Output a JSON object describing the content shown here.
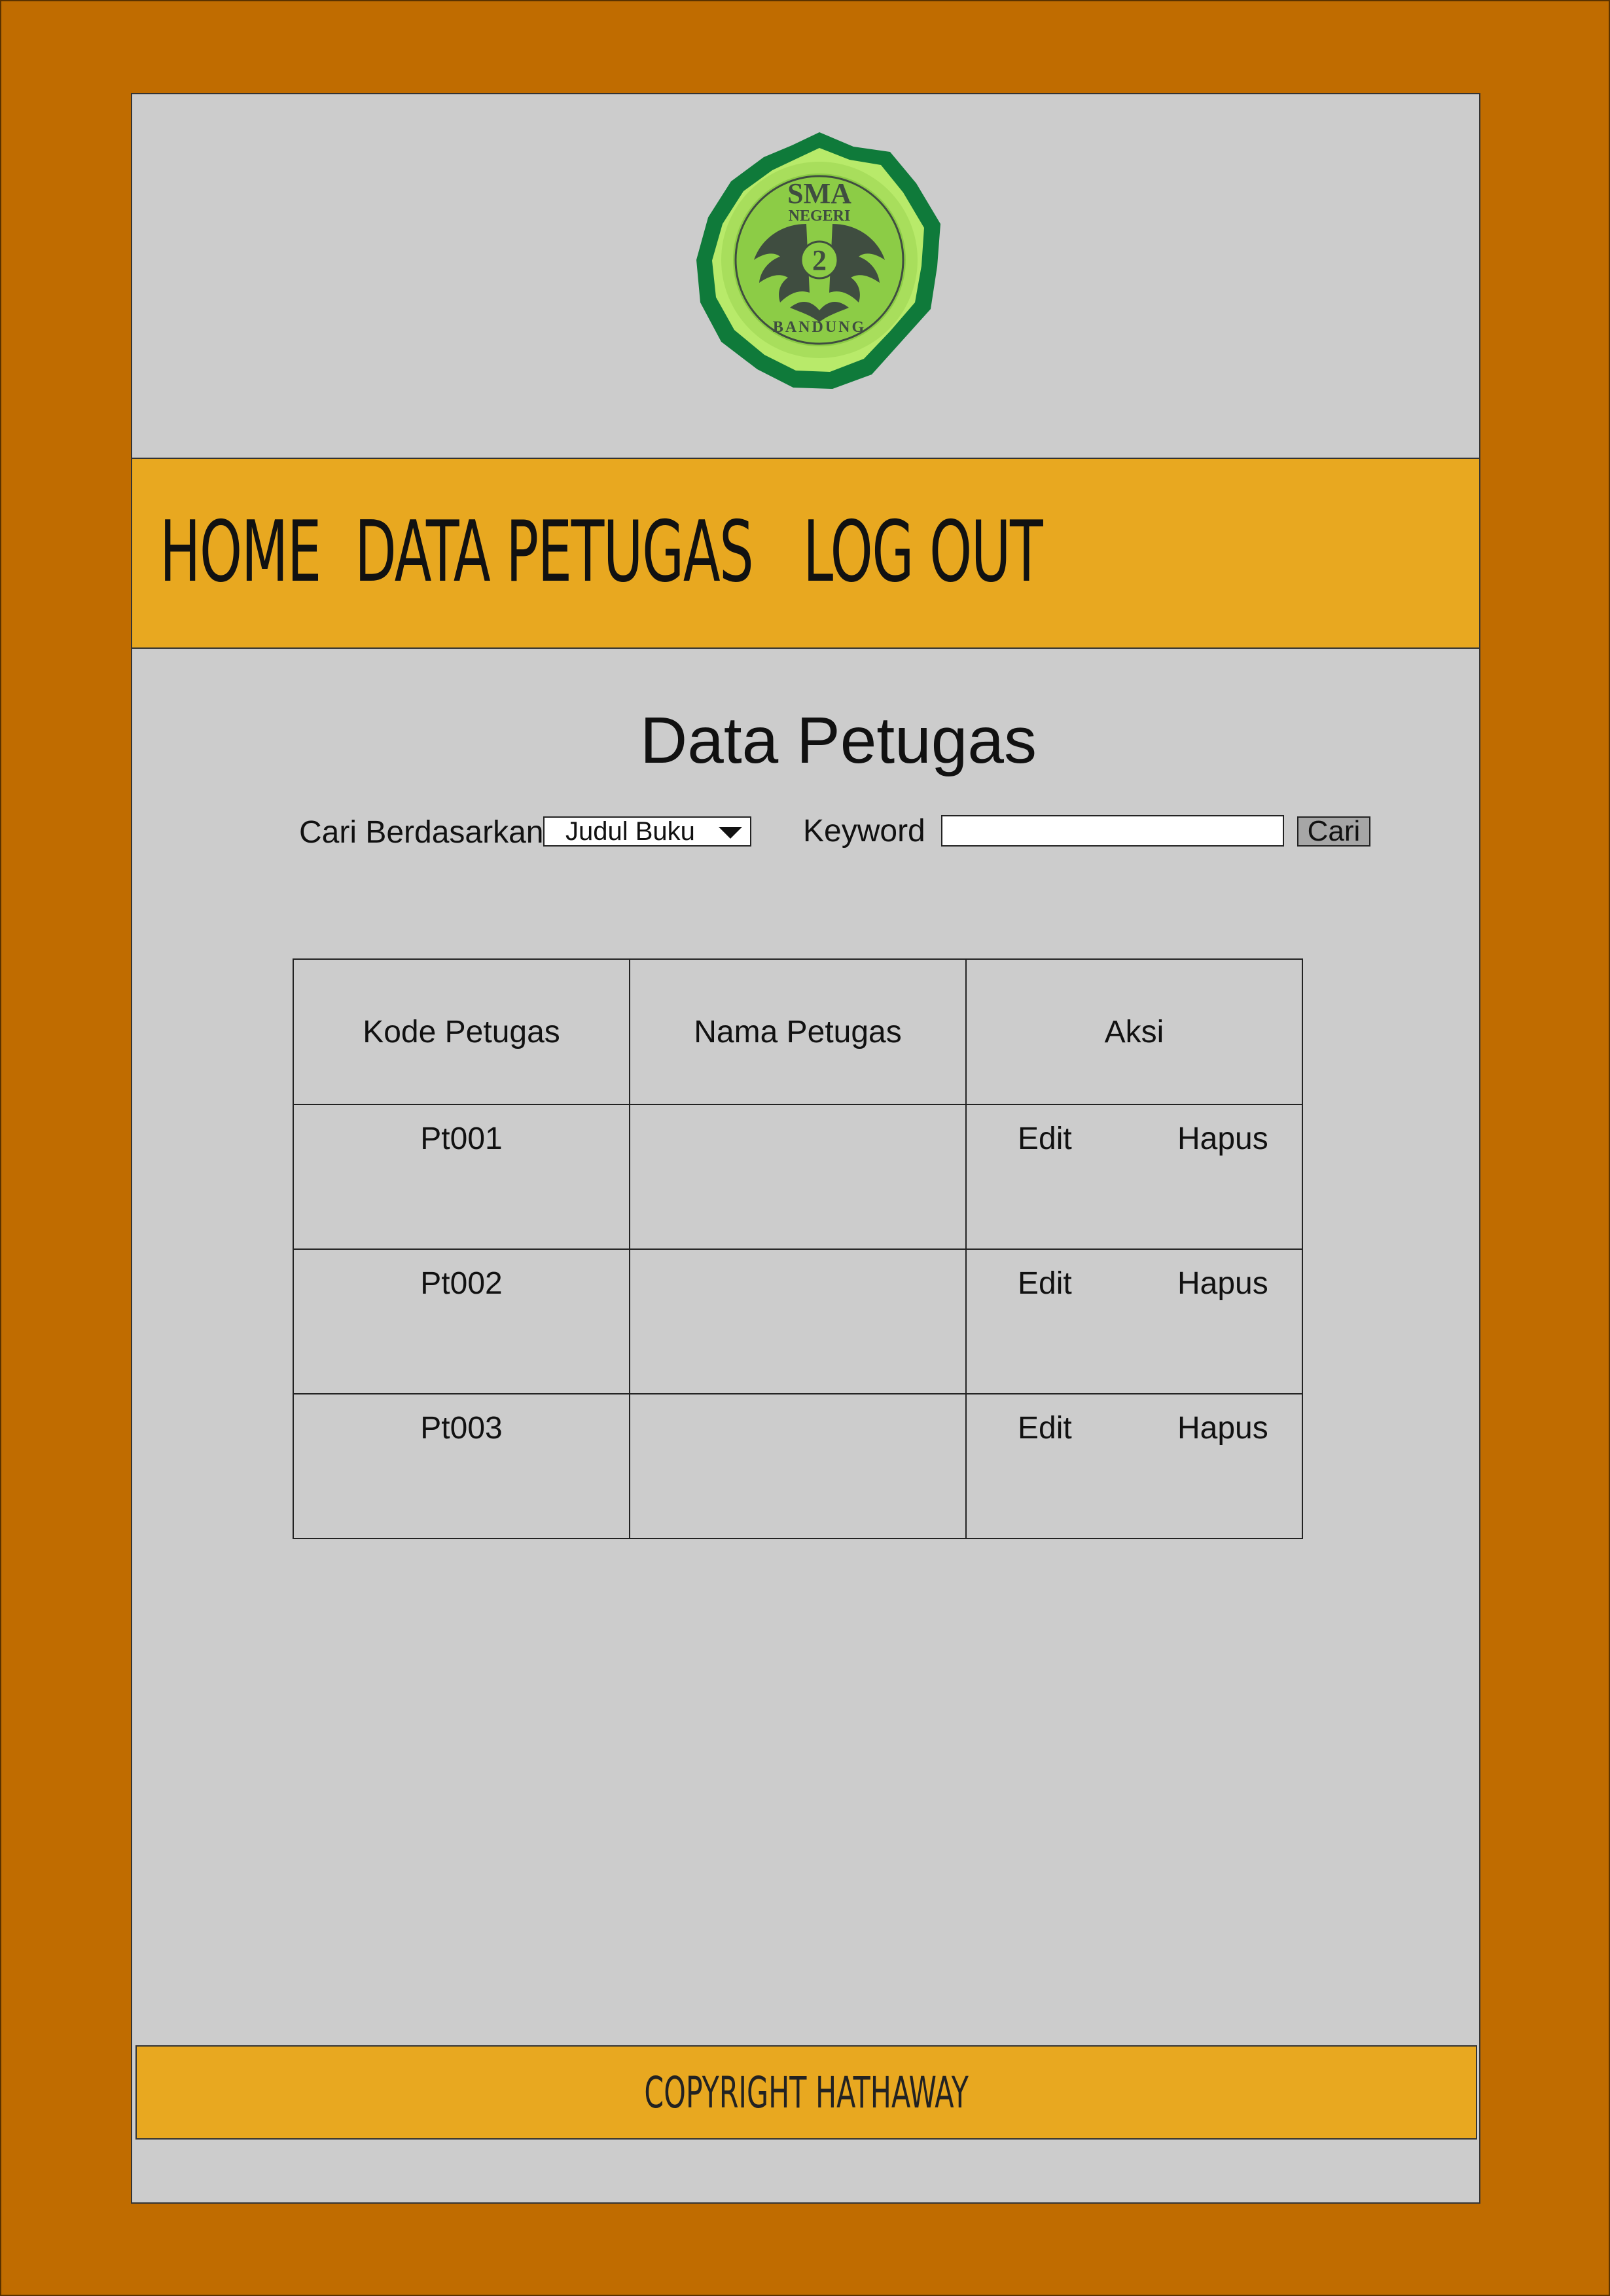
{
  "logo": {
    "name": "school-logo",
    "text_top": "SMA",
    "text_mid": "NEGERI",
    "number": "2",
    "text_bottom": "BANDUNG",
    "colors": {
      "outer": "#0f7a3a",
      "inner": "#b8ea6a",
      "mid": "#8ccc46",
      "emblem": "#3f4d40"
    }
  },
  "nav": {
    "home": "HOME",
    "data_petugas": "DATA PETUGAS",
    "logout": "LOG OUT"
  },
  "page": {
    "title": "Data Petugas"
  },
  "search": {
    "label": "Cari Berdasarkan",
    "select_value": "Judul Buku",
    "keyword_label": "Keyword",
    "keyword_value": "",
    "button": "Cari"
  },
  "table": {
    "headers": [
      "Kode Petugas",
      "Nama Petugas",
      "Aksi"
    ],
    "rows": [
      {
        "kode": "Pt001",
        "nama": "",
        "edit": "Edit",
        "hapus": "Hapus"
      },
      {
        "kode": "Pt002",
        "nama": "",
        "edit": "Edit",
        "hapus": "Hapus"
      },
      {
        "kode": "Pt003",
        "nama": "",
        "edit": "Edit",
        "hapus": "Hapus"
      }
    ]
  },
  "footer": {
    "text": "COPYRIGHT HATHAWAY"
  },
  "colors": {
    "frame": "#c06c00",
    "page": "#cccccc",
    "bar": "#e8a820"
  }
}
